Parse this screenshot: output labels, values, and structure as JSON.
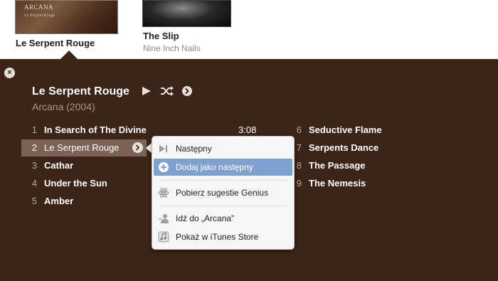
{
  "albums": [
    {
      "cover_text": "ARCANA",
      "cover_subtext": "Le Serpent Rouge",
      "title": "Le Serpent Rouge",
      "artist": ""
    },
    {
      "cover_text": "",
      "cover_subtext": "",
      "title": "The Slip",
      "artist": "Nine Inch Nails"
    }
  ],
  "detail": {
    "title": "Le Serpent Rouge",
    "subtitle": "Arcana (2004)",
    "close_label": "×"
  },
  "tracks_left": [
    {
      "num": "1",
      "name": "In Search of The Divine",
      "time": "3:08"
    },
    {
      "num": "2",
      "name": "Le Serpent Rouge",
      "time": ""
    },
    {
      "num": "3",
      "name": "Cathar",
      "time": ""
    },
    {
      "num": "4",
      "name": "Under the Sun",
      "time": ""
    },
    {
      "num": "5",
      "name": "Amber",
      "time": ""
    }
  ],
  "tracks_right": [
    {
      "num": "6",
      "name": "Seductive Flame"
    },
    {
      "num": "7",
      "name": "Serpents Dance"
    },
    {
      "num": "8",
      "name": "The Passage"
    },
    {
      "num": "9",
      "name": "The Nemesis"
    }
  ],
  "context_menu": {
    "items": [
      {
        "label": "Następny",
        "icon": "next-icon"
      },
      {
        "label": "Dodaj jako następny",
        "icon": "add-icon",
        "highlighted": true
      },
      {
        "label": "Pobierz sugestie Genius",
        "icon": "genius-icon"
      },
      {
        "label": "Idź do „Arcana”",
        "icon": "artist-icon"
      },
      {
        "label": "Pokaż w iTunes Store",
        "icon": "store-icon"
      }
    ]
  },
  "colors": {
    "background": "#3c2418",
    "selected_row": "#7b6254",
    "menu_highlight": "#7fa1cf"
  }
}
